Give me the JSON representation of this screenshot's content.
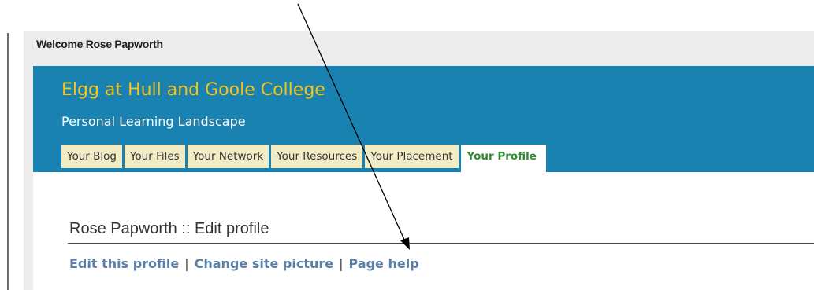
{
  "welcome": {
    "text": "Welcome Rose Papworth"
  },
  "site": {
    "title": "Elgg at Hull and Goole College",
    "subtitle": "Personal Learning Landscape"
  },
  "tabs": [
    {
      "label": "Your Blog",
      "active": false
    },
    {
      "label": "Your Files",
      "active": false
    },
    {
      "label": "Your Network",
      "active": false
    },
    {
      "label": "Your Resources",
      "active": false
    },
    {
      "label": "Your Placement",
      "active": false
    },
    {
      "label": "Your Profile",
      "active": true
    }
  ],
  "page": {
    "title": "Rose Papworth :: Edit profile"
  },
  "links": {
    "edit_profile": "Edit this profile",
    "separator": "|",
    "change_picture": "Change site picture",
    "page_help": "Page help"
  },
  "colors": {
    "header_bg": "#1a82b0",
    "title_color": "#f3c41e",
    "tab_bg": "#f2ecc6",
    "active_tab_text": "#2e8b2e",
    "link_color": "#5b7fa6"
  }
}
